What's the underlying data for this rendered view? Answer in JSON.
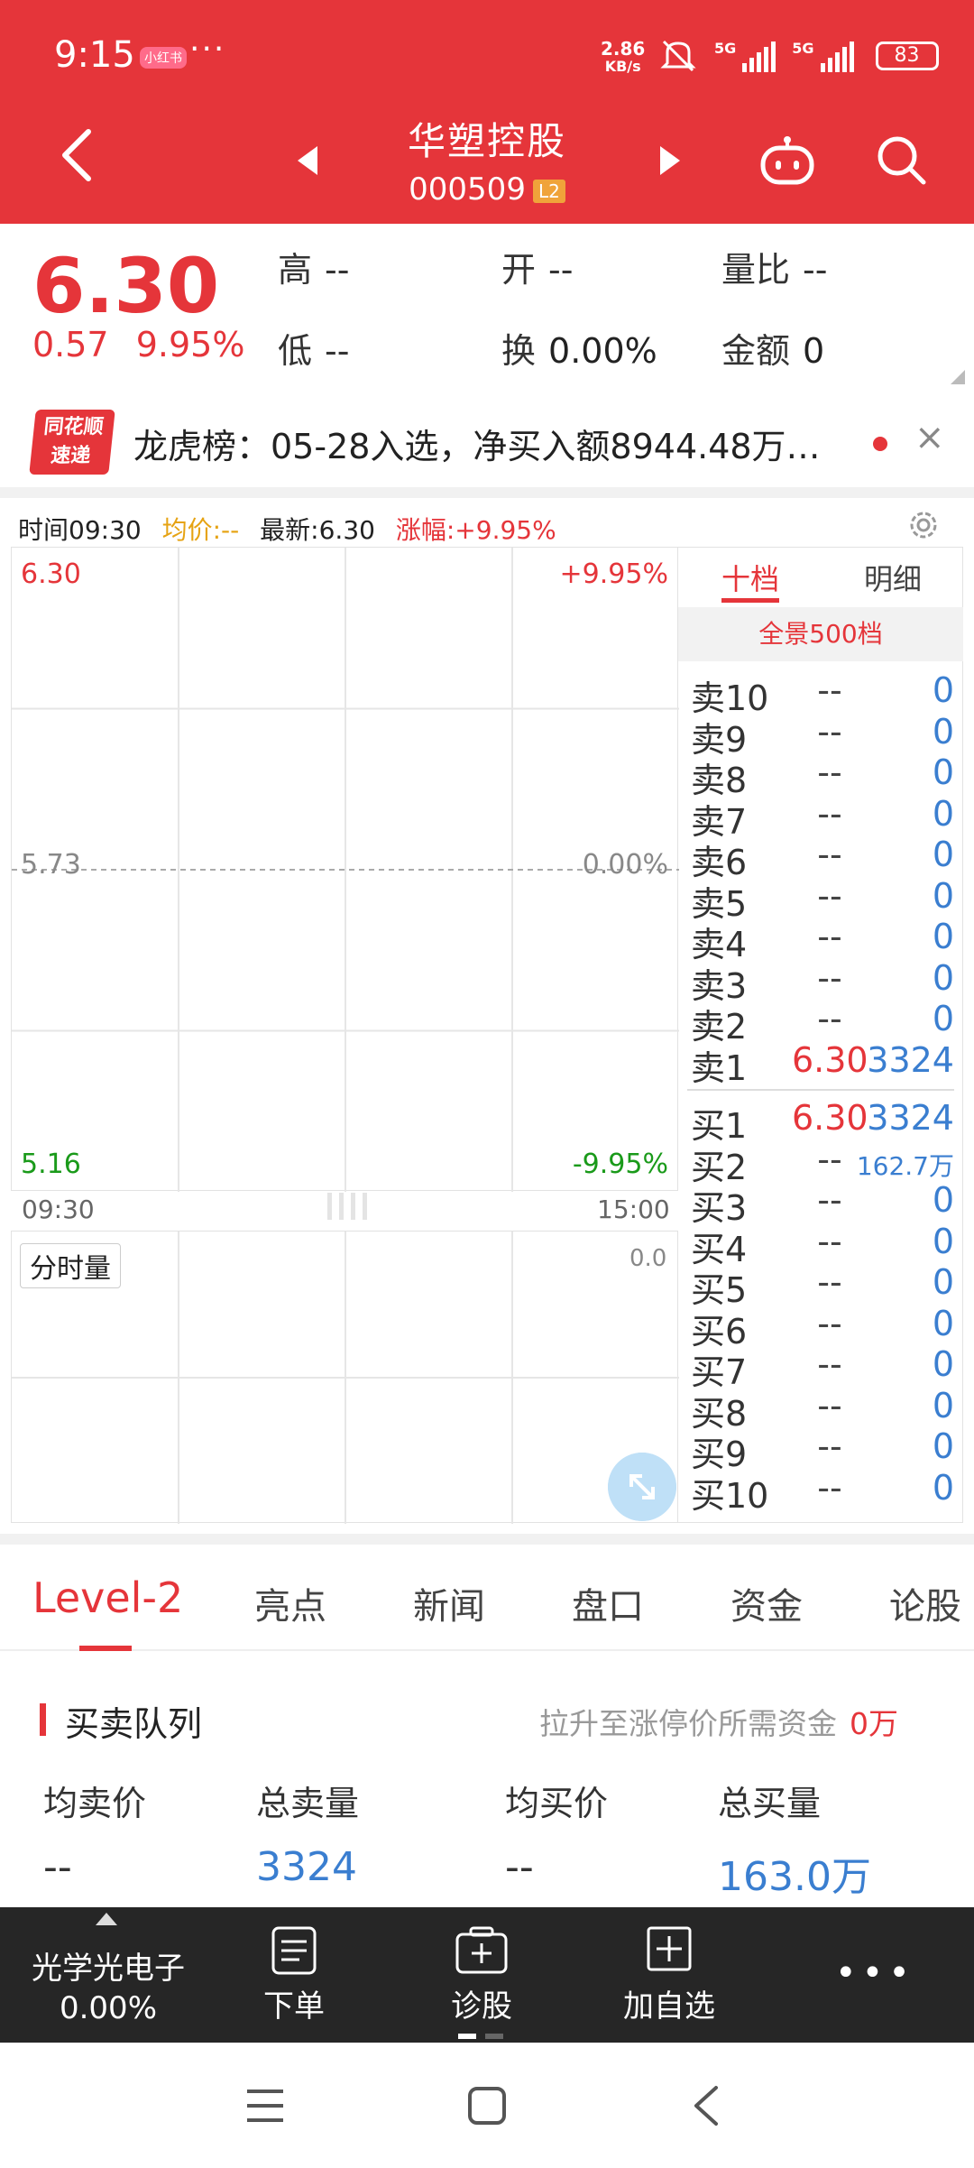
{
  "status": {
    "time": "9:15",
    "app_badge": "小红书",
    "more": "···",
    "speed": "2.86",
    "speed_unit": "KB/s",
    "net1": "5G",
    "net2": "5G",
    "battery": "83"
  },
  "header": {
    "stock_name": "华塑控股",
    "stock_code": "000509",
    "level_badge": "L2"
  },
  "quote": {
    "price": "6.30",
    "change": "0.57",
    "change_pct": "9.95%",
    "high_label": "高",
    "high_value": "--",
    "low_label": "低",
    "low_value": "--",
    "open_label": "开",
    "open_value": "--",
    "turnover_label": "换",
    "turnover_value": "0.00%",
    "vol_ratio_label": "量比",
    "vol_ratio_value": "--",
    "amount_label": "金额",
    "amount_value": "0"
  },
  "news": {
    "logo_line1": "同花顺",
    "logo_line2": "速递",
    "text": "龙虎榜：05-28入选，净买入额8944.48万…",
    "close": "×"
  },
  "chart_meta": {
    "time": "时间09:30",
    "avg": "均价:--",
    "latest": "最新:6.30",
    "change": "涨幅:+9.95%"
  },
  "chart_data": {
    "type": "line",
    "title": "",
    "y_left_labels": [
      "6.30",
      "5.73",
      "5.16"
    ],
    "y_right_labels": [
      "+9.95%",
      "0.00%",
      "-9.95%"
    ],
    "x_labels": [
      "09:30",
      "15:00"
    ],
    "ylim": [
      5.16,
      6.3
    ],
    "x": [],
    "series": [],
    "grid": true
  },
  "volume_chart": {
    "label": "分时量",
    "max": "0.0"
  },
  "colors": {
    "up": "#e5353a",
    "down": "#1a9a1a",
    "volume": "#3a7ed0",
    "header_bg": "#e5353a"
  },
  "orderbook": {
    "tab_ten": "十档",
    "tab_detail": "明细",
    "full_depth": "全景500档",
    "sell": [
      {
        "label": "卖10",
        "price": "--",
        "volume": "0"
      },
      {
        "label": "卖9",
        "price": "--",
        "volume": "0"
      },
      {
        "label": "卖8",
        "price": "--",
        "volume": "0"
      },
      {
        "label": "卖7",
        "price": "--",
        "volume": "0"
      },
      {
        "label": "卖6",
        "price": "--",
        "volume": "0"
      },
      {
        "label": "卖5",
        "price": "--",
        "volume": "0"
      },
      {
        "label": "卖4",
        "price": "--",
        "volume": "0"
      },
      {
        "label": "卖3",
        "price": "--",
        "volume": "0"
      },
      {
        "label": "卖2",
        "price": "--",
        "volume": "0"
      },
      {
        "label": "卖1",
        "price": "6.30",
        "volume": "3324"
      }
    ],
    "buy": [
      {
        "label": "买1",
        "price": "6.30",
        "volume": "3324"
      },
      {
        "label": "买2",
        "price": "--",
        "volume": "162.7万"
      },
      {
        "label": "买3",
        "price": "--",
        "volume": "0"
      },
      {
        "label": "买4",
        "price": "--",
        "volume": "0"
      },
      {
        "label": "买5",
        "price": "--",
        "volume": "0"
      },
      {
        "label": "买6",
        "price": "--",
        "volume": "0"
      },
      {
        "label": "买7",
        "price": "--",
        "volume": "0"
      },
      {
        "label": "买8",
        "price": "--",
        "volume": "0"
      },
      {
        "label": "买9",
        "price": "--",
        "volume": "0"
      },
      {
        "label": "买10",
        "price": "--",
        "volume": "0"
      }
    ]
  },
  "section_tabs": [
    "Level-2",
    "亮点",
    "新闻",
    "盘口",
    "资金",
    "论股"
  ],
  "queue": {
    "title": "买卖队列",
    "hint": "拉升至涨停价所需资金",
    "hint_value": "0万",
    "headers": [
      "均卖价",
      "总卖量",
      "均买价",
      "总买量"
    ],
    "values": [
      "--",
      "3324",
      "--",
      "163.0万"
    ]
  },
  "toolbar": {
    "sector_name": "光学光电子",
    "sector_pct": "0.00%",
    "order": "下单",
    "diagnose": "诊股",
    "add_watch": "加自选",
    "more": "•••"
  }
}
